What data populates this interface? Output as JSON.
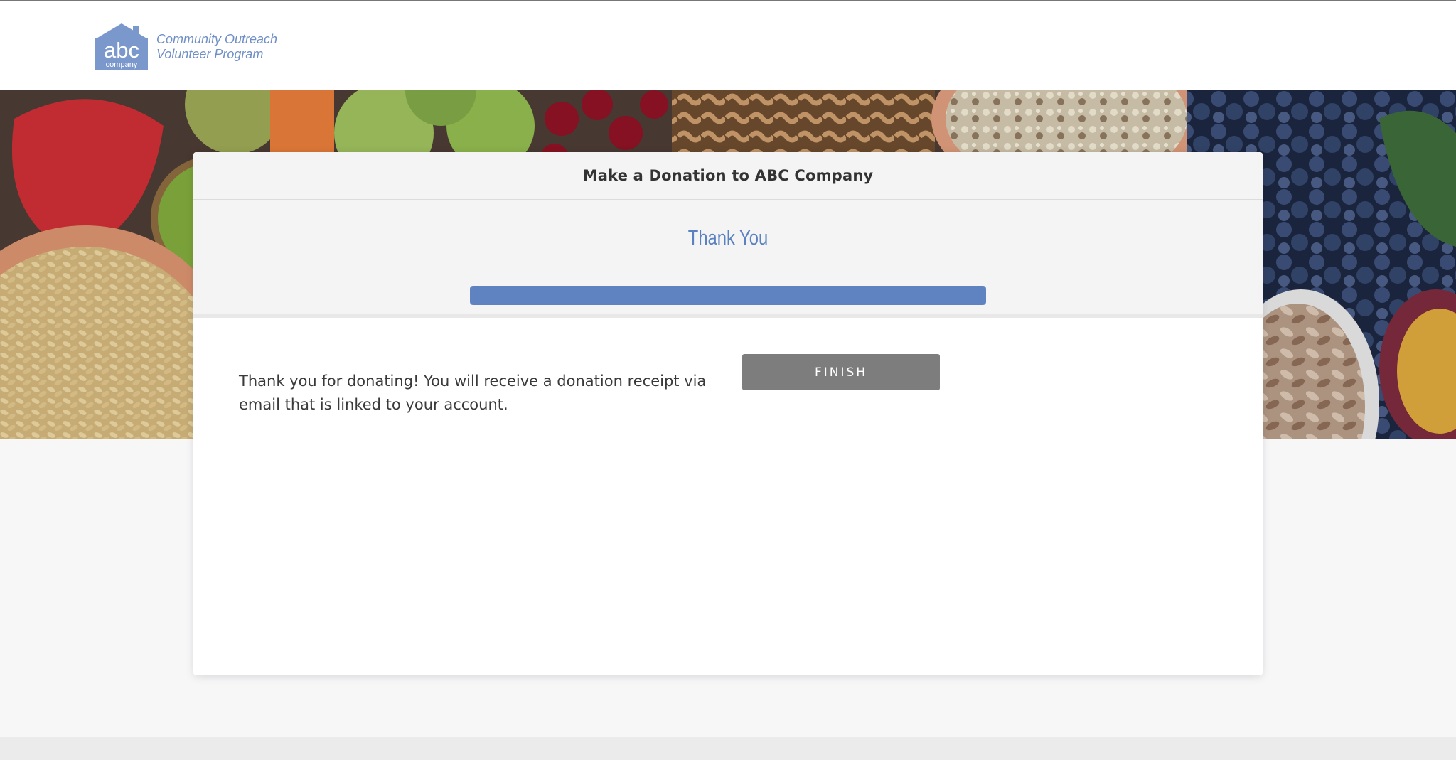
{
  "header": {
    "logo": {
      "mark_text": "abc",
      "mark_subtext": "company",
      "line1": "Community Outreach",
      "line2": "Volunteer Program",
      "brand_color": "#6f8fc6"
    }
  },
  "hero": {
    "image_description_icon": "produce-banner-image"
  },
  "card": {
    "title": "Make a Donation to ABC Company",
    "step": {
      "title": "Thank You",
      "progress_percent": 100,
      "accent_color": "#5f83c1"
    },
    "message": "Thank you for donating! You will receive a donation receipt via email that is linked to your account.",
    "finish_label": "FINISH"
  }
}
